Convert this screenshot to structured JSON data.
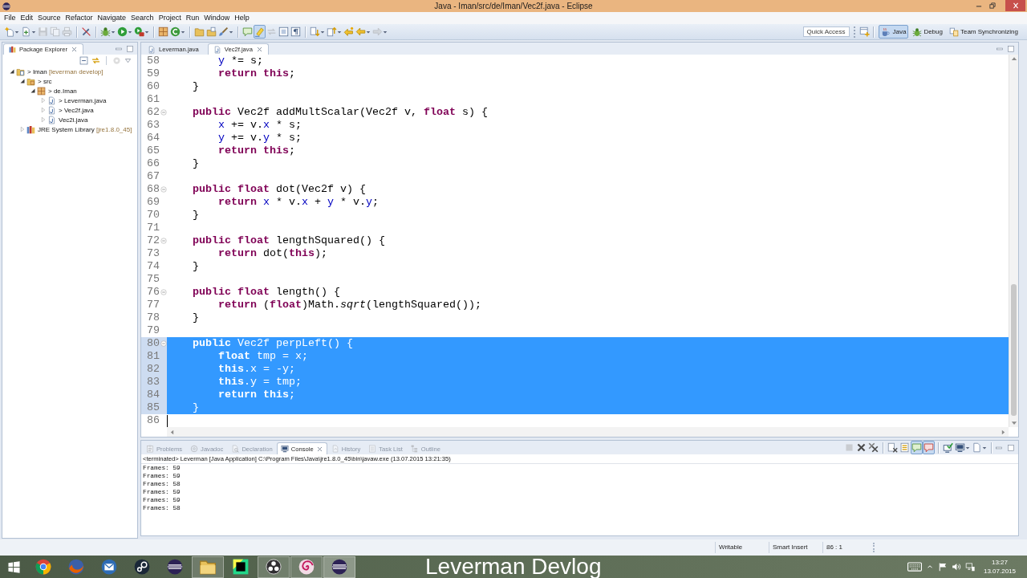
{
  "window": {
    "title": "Java - Iman/src/de/Iman/Vec2f.java - Eclipse"
  },
  "menu": [
    "File",
    "Edit",
    "Source",
    "Refactor",
    "Navigate",
    "Search",
    "Project",
    "Run",
    "Window",
    "Help"
  ],
  "toolbar": {
    "groups": [
      [
        {
          "kind": "page_star",
          "dropdown": true,
          "pressed": false,
          "disabled": false
        },
        {
          "kind": "page_plus",
          "dropdown": true,
          "pressed": false,
          "disabled": false
        },
        {
          "kind": "disk",
          "dropdown": false,
          "pressed": false,
          "disabled": true
        },
        {
          "kind": "pages",
          "dropdown": false,
          "pressed": false,
          "disabled": true
        },
        {
          "kind": "printer",
          "dropdown": false,
          "pressed": false,
          "disabled": true
        }
      ],
      [
        {
          "kind": "slash",
          "dropdown": false,
          "pressed": false,
          "disabled": false
        }
      ],
      [
        {
          "kind": "bug",
          "dropdown": true,
          "pressed": false,
          "disabled": false
        },
        {
          "kind": "play",
          "dropdown": true,
          "pressed": false,
          "disabled": false
        },
        {
          "kind": "toolbox",
          "dropdown": true,
          "pressed": false,
          "disabled": false
        }
      ],
      [
        {
          "kind": "grid",
          "dropdown": false,
          "pressed": false,
          "disabled": false
        },
        {
          "kind": "arc_disc",
          "dropdown": true,
          "pressed": false,
          "disabled": false
        }
      ],
      [
        {
          "kind": "folder",
          "dropdown": false,
          "pressed": false,
          "disabled": false
        },
        {
          "kind": "folder_page",
          "dropdown": false,
          "pressed": false,
          "disabled": false
        },
        {
          "kind": "brush",
          "dropdown": true,
          "pressed": false,
          "disabled": false
        }
      ],
      [
        {
          "kind": "bubble",
          "dropdown": false,
          "pressed": false,
          "disabled": false
        },
        {
          "kind": "marker",
          "dropdown": false,
          "pressed": true,
          "disabled": false
        },
        {
          "kind": "arrows",
          "dropdown": false,
          "pressed": false,
          "disabled": true
        },
        {
          "kind": "frame",
          "dropdown": false,
          "pressed": false,
          "disabled": false
        },
        {
          "kind": "pilcrow",
          "dropdown": false,
          "pressed": false,
          "disabled": false
        }
      ],
      [
        {
          "kind": "page_down",
          "dropdown": true,
          "pressed": false,
          "disabled": false
        },
        {
          "kind": "page_up",
          "dropdown": true,
          "pressed": false,
          "disabled": false
        },
        {
          "kind": "arrow_left_star",
          "dropdown": false,
          "pressed": false,
          "disabled": false
        },
        {
          "kind": "arrow_left",
          "dropdown": true,
          "pressed": false,
          "disabled": false
        },
        {
          "kind": "arrow_right",
          "dropdown": true,
          "pressed": false,
          "disabled": true
        }
      ]
    ],
    "quick_access": {
      "placeholder": "Quick Access"
    },
    "perspectives": [
      {
        "label": "Java",
        "kind": "cup",
        "selected": true
      },
      {
        "label": "Debug",
        "kind": "bug",
        "selected": false
      },
      {
        "label": "Team Synchronizing",
        "kind": "two_pages",
        "selected": false
      }
    ]
  },
  "package_explorer": {
    "tab": {
      "label": "Package Explorer",
      "selected": true
    },
    "tree": [
      {
        "label": "> Iman",
        "decoration": "[leverman develop]",
        "kind": "project",
        "expanded": true,
        "children": [
          {
            "label": "> src",
            "kind": "source_folder",
            "expanded": true,
            "children": [
              {
                "label": "> de.Iman",
                "kind": "package",
                "expanded": true,
                "children": [
                  {
                    "label": "> Leverman.java",
                    "kind": "java_file",
                    "expanded": false
                  },
                  {
                    "label": "> Vec2f.java",
                    "kind": "java_file",
                    "expanded": false
                  },
                  {
                    "label": "Vec2i.java",
                    "kind": "java_file",
                    "expanded": false
                  }
                ]
              }
            ]
          },
          {
            "label": "JRE System Library",
            "decoration": "[jre1.8.0_45]",
            "kind": "library",
            "expanded": false
          }
        ]
      }
    ]
  },
  "editor": {
    "tabs": [
      {
        "label": "Leverman.java",
        "selected": false
      },
      {
        "label": "Vec2f.java",
        "selected": true
      }
    ],
    "lines": [
      {
        "number": "58",
        "selected": false,
        "fold_marker": false,
        "caret": false,
        "code": [
          {
            "kind": "field",
            "text": "        y"
          },
          {
            "kind": "plain",
            "text": " *= s;"
          }
        ]
      },
      {
        "number": "59",
        "selected": false,
        "fold_marker": false,
        "caret": false,
        "code": [
          {
            "kind": "keyword",
            "text": "        return this"
          },
          {
            "kind": "plain",
            "text": ";"
          }
        ]
      },
      {
        "number": "60",
        "selected": false,
        "fold_marker": false,
        "caret": false,
        "code": [
          {
            "kind": "plain",
            "text": "    }"
          }
        ]
      },
      {
        "number": "61",
        "selected": false,
        "fold_marker": false,
        "caret": false
      },
      {
        "number": "62",
        "selected": false,
        "fold_marker": true,
        "caret": false,
        "code": [
          {
            "kind": "keyword",
            "text": "    public"
          },
          {
            "kind": "plain",
            "text": " Vec2f addMultScalar(Vec2f v, "
          },
          {
            "kind": "keyword",
            "text": "float"
          },
          {
            "kind": "plain",
            "text": " s) {"
          }
        ]
      },
      {
        "number": "63",
        "selected": false,
        "fold_marker": false,
        "caret": false,
        "code": [
          {
            "kind": "field",
            "text": "        x"
          },
          {
            "kind": "plain",
            "text": " += v."
          },
          {
            "kind": "field",
            "text": "x"
          },
          {
            "kind": "plain",
            "text": " * s;"
          }
        ]
      },
      {
        "number": "64",
        "selected": false,
        "fold_marker": false,
        "caret": false,
        "code": [
          {
            "kind": "field",
            "text": "        y"
          },
          {
            "kind": "plain",
            "text": " += v."
          },
          {
            "kind": "field",
            "text": "y"
          },
          {
            "kind": "plain",
            "text": " * s;"
          }
        ]
      },
      {
        "number": "65",
        "selected": false,
        "fold_marker": false,
        "caret": false,
        "code": [
          {
            "kind": "keyword",
            "text": "        return this"
          },
          {
            "kind": "plain",
            "text": ";"
          }
        ]
      },
      {
        "number": "66",
        "selected": false,
        "fold_marker": false,
        "caret": false,
        "code": [
          {
            "kind": "plain",
            "text": "    }"
          }
        ]
      },
      {
        "number": "67",
        "selected": false,
        "fold_marker": false,
        "caret": false
      },
      {
        "number": "68",
        "selected": false,
        "fold_marker": true,
        "caret": false,
        "code": [
          {
            "kind": "keyword",
            "text": "    public float"
          },
          {
            "kind": "plain",
            "text": " dot(Vec2f v) {"
          }
        ]
      },
      {
        "number": "69",
        "selected": false,
        "fold_marker": false,
        "caret": false,
        "code": [
          {
            "kind": "keyword",
            "text": "        return"
          },
          {
            "kind": "field",
            "text": " x"
          },
          {
            "kind": "plain",
            "text": " * v."
          },
          {
            "kind": "field",
            "text": "x"
          },
          {
            "kind": "plain",
            "text": " + "
          },
          {
            "kind": "field",
            "text": "y"
          },
          {
            "kind": "plain",
            "text": " * v."
          },
          {
            "kind": "field",
            "text": "y"
          },
          {
            "kind": "plain",
            "text": ";"
          }
        ]
      },
      {
        "number": "70",
        "selected": false,
        "fold_marker": false,
        "caret": false,
        "code": [
          {
            "kind": "plain",
            "text": "    }"
          }
        ]
      },
      {
        "number": "71",
        "selected": false,
        "fold_marker": false,
        "caret": false
      },
      {
        "number": "72",
        "selected": false,
        "fold_marker": true,
        "caret": false,
        "code": [
          {
            "kind": "keyword",
            "text": "    public float"
          },
          {
            "kind": "plain",
            "text": " lengthSquared() {"
          }
        ]
      },
      {
        "number": "73",
        "selected": false,
        "fold_marker": false,
        "caret": false,
        "code": [
          {
            "kind": "keyword",
            "text": "        return"
          },
          {
            "kind": "plain",
            "text": " dot("
          },
          {
            "kind": "keyword",
            "text": "this"
          },
          {
            "kind": "plain",
            "text": ");"
          }
        ]
      },
      {
        "number": "74",
        "selected": false,
        "fold_marker": false,
        "caret": false,
        "code": [
          {
            "kind": "plain",
            "text": "    }"
          }
        ]
      },
      {
        "number": "75",
        "selected": false,
        "fold_marker": false,
        "caret": false
      },
      {
        "number": "76",
        "selected": false,
        "fold_marker": true,
        "caret": false,
        "code": [
          {
            "kind": "keyword",
            "text": "    public float"
          },
          {
            "kind": "plain",
            "text": " length() {"
          }
        ]
      },
      {
        "number": "77",
        "selected": false,
        "fold_marker": false,
        "caret": false,
        "code": [
          {
            "kind": "keyword",
            "text": "        return"
          },
          {
            "kind": "plain",
            "text": " ("
          },
          {
            "kind": "keyword",
            "text": "float"
          },
          {
            "kind": "plain",
            "text": ")Math."
          },
          {
            "kind": "static",
            "text": "sqrt"
          },
          {
            "kind": "plain",
            "text": "(lengthSquared());"
          }
        ]
      },
      {
        "number": "78",
        "selected": false,
        "fold_marker": false,
        "caret": false,
        "code": [
          {
            "kind": "plain",
            "text": "    }"
          }
        ]
      },
      {
        "number": "79",
        "selected": false,
        "fold_marker": false,
        "caret": false
      },
      {
        "number": "80",
        "selected": true,
        "fold_marker": true,
        "caret": false,
        "code": [
          {
            "kind": "keyword",
            "text": "    public"
          },
          {
            "kind": "plain",
            "text": " Vec2f perpLeft() {"
          }
        ]
      },
      {
        "number": "81",
        "selected": true,
        "fold_marker": false,
        "caret": false,
        "code": [
          {
            "kind": "keyword",
            "text": "        float"
          },
          {
            "kind": "plain",
            "text": " tmp = "
          },
          {
            "kind": "field",
            "text": "x"
          },
          {
            "kind": "plain",
            "text": ";"
          }
        ]
      },
      {
        "number": "82",
        "selected": true,
        "fold_marker": false,
        "caret": false,
        "code": [
          {
            "kind": "keyword",
            "text": "        this"
          },
          {
            "kind": "plain",
            "text": "."
          },
          {
            "kind": "field",
            "text": "x"
          },
          {
            "kind": "plain",
            "text": " = -"
          },
          {
            "kind": "field",
            "text": "y"
          },
          {
            "kind": "plain",
            "text": ";"
          }
        ]
      },
      {
        "number": "83",
        "selected": true,
        "fold_marker": false,
        "caret": false,
        "code": [
          {
            "kind": "keyword",
            "text": "        this"
          },
          {
            "kind": "plain",
            "text": "."
          },
          {
            "kind": "field",
            "text": "y"
          },
          {
            "kind": "plain",
            "text": " = tmp;"
          }
        ]
      },
      {
        "number": "84",
        "selected": true,
        "fold_marker": false,
        "caret": false,
        "code": [
          {
            "kind": "keyword",
            "text": "        return this"
          },
          {
            "kind": "plain",
            "text": ";"
          }
        ]
      },
      {
        "number": "85",
        "selected": true,
        "fold_marker": false,
        "caret": false,
        "code": [
          {
            "kind": "plain",
            "text": "    }"
          }
        ]
      },
      {
        "number": "86",
        "selected": false,
        "fold_marker": false,
        "caret": true
      }
    ]
  },
  "console_view": {
    "tabs": [
      {
        "label": "Problems",
        "kind": "clipboard",
        "selected": false
      },
      {
        "label": "Javadoc",
        "kind": "ring",
        "selected": false
      },
      {
        "label": "Declaration",
        "kind": "page_lens",
        "selected": false
      },
      {
        "label": "Console",
        "kind": "monitor",
        "selected": true
      },
      {
        "label": "History",
        "kind": "page_arrow",
        "selected": false
      },
      {
        "label": "Task List",
        "kind": "list",
        "selected": false
      },
      {
        "label": "Outline",
        "kind": "tree_list",
        "selected": false
      }
    ],
    "toolbar": [
      [
        {
          "kind": "square",
          "dropdown": false,
          "pressed": false,
          "disabled": true
        },
        {
          "kind": "cross",
          "dropdown": false,
          "pressed": false,
          "disabled": false
        },
        {
          "kind": "double_cross",
          "dropdown": false,
          "pressed": false,
          "disabled": false
        }
      ],
      [
        {
          "kind": "page_cross",
          "dropdown": false,
          "pressed": false,
          "disabled": false
        },
        {
          "kind": "page_lines",
          "dropdown": false,
          "pressed": false,
          "disabled": false
        },
        {
          "kind": "bubble",
          "dropdown": false,
          "pressed": true,
          "disabled": false
        },
        {
          "kind": "bubble_red",
          "dropdown": false,
          "pressed": true,
          "disabled": false
        }
      ],
      [
        {
          "kind": "monitor_check",
          "dropdown": false,
          "pressed": false,
          "disabled": false
        },
        {
          "kind": "monitor",
          "dropdown": true,
          "pressed": false,
          "disabled": false
        },
        {
          "kind": "page",
          "dropdown": true,
          "pressed": false,
          "disabled": false
        }
      ]
    ],
    "description": "<terminated> Leverman [Java Application] C:\\Program Files\\Java\\jre1.8.0_45\\bin\\javaw.exe (13.07.2015 13:21:35)",
    "output": [
      "Frames: 59",
      "Frames: 59",
      "Frames: 58",
      "Frames: 59",
      "Frames: 59",
      "Frames: 58"
    ]
  },
  "status_bar": [
    "Writable",
    "Smart Insert",
    "86 : 1"
  ],
  "taskbar": {
    "apps": [
      {
        "kind": "segmented_circle",
        "running": false,
        "selected": false
      },
      {
        "kind": "globe_swirl",
        "running": false,
        "selected": false
      },
      {
        "kind": "envelope_circle",
        "running": false,
        "selected": false
      },
      {
        "kind": "disc_rings",
        "running": false,
        "selected": false
      },
      {
        "kind": "striped_circle",
        "running": false,
        "selected": false
      },
      {
        "kind": "folder_big",
        "running": true,
        "selected": false
      },
      {
        "kind": "tile",
        "running": false,
        "selected": false
      },
      {
        "kind": "three_dot_circle",
        "running": true,
        "selected": false
      },
      {
        "kind": "spiral_circle",
        "running": true,
        "selected": false
      },
      {
        "kind": "striped_circle",
        "running": true,
        "selected": true
      }
    ],
    "overlay_title": "Leverman Devlog",
    "clock": {
      "time": "13:27",
      "date": "13.07.2015"
    }
  }
}
